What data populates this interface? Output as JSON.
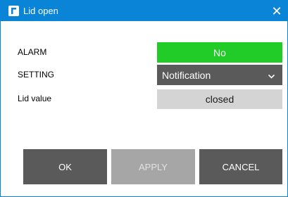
{
  "window": {
    "title": "Lid open",
    "app_icon": "brand-c-icon",
    "close_icon": "close-icon",
    "close_glyph": "✕"
  },
  "rows": {
    "alarm": {
      "label": "ALARM",
      "value": "No",
      "color": "#21cc28"
    },
    "setting": {
      "label": "SETTING",
      "value": "Notification",
      "icon": "chevron-down-icon"
    },
    "lid": {
      "label": "Lid value",
      "value": "closed"
    }
  },
  "buttons": {
    "ok": "OK",
    "apply": "APPLY",
    "cancel": "CANCEL"
  },
  "colors": {
    "titlebar": "#0a84d6",
    "button": "#5a5a5a",
    "button_disabled": "#a6a6a6"
  }
}
